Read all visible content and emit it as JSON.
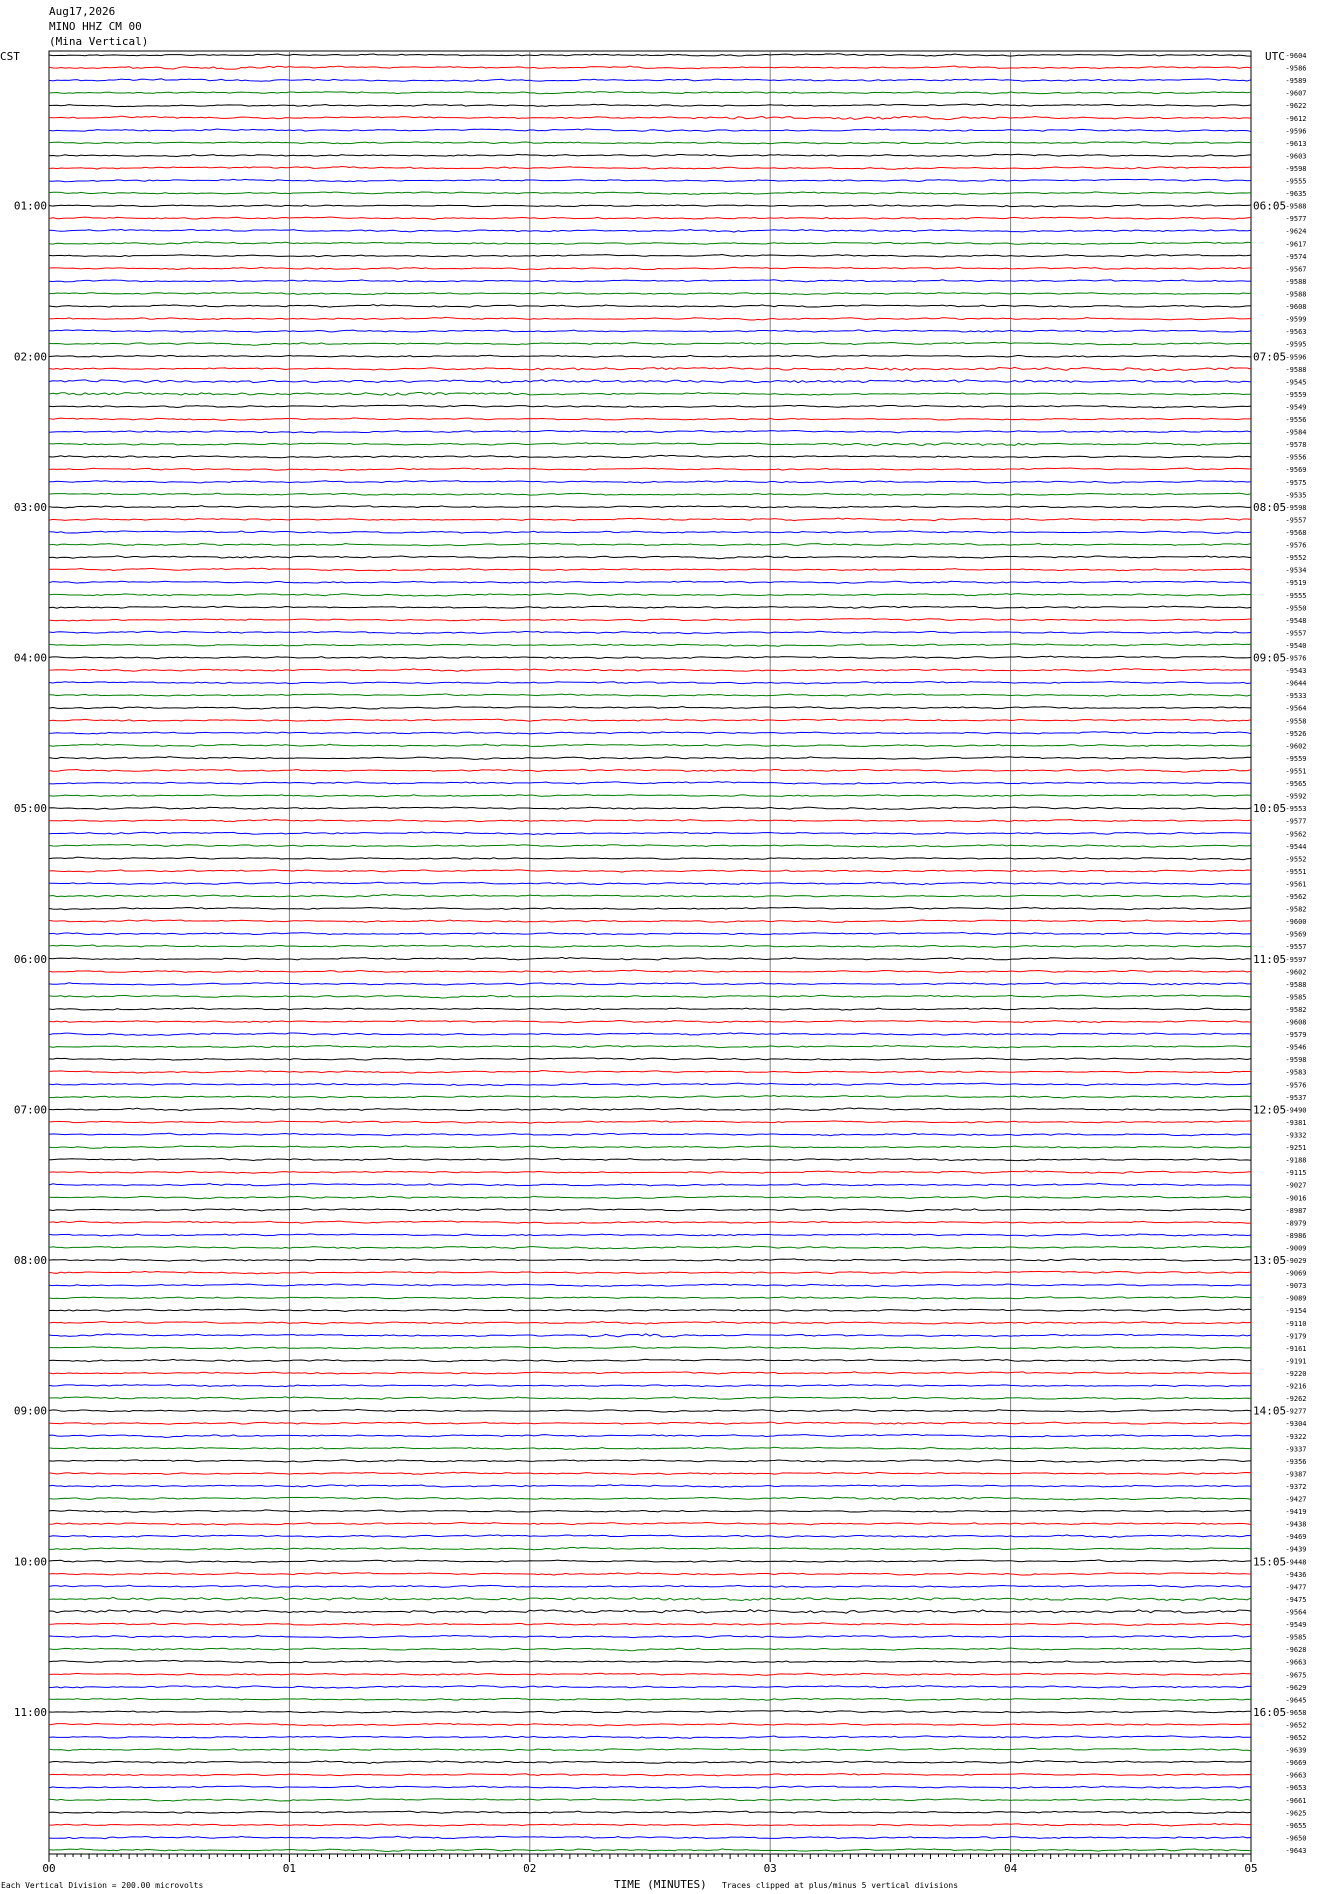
{
  "header": {
    "date": "Aug17,2026",
    "station": "MINO HHZ CM 00",
    "location": "(Mina Vertical)"
  },
  "left_timezone": "CST",
  "right_timezone": "UTC",
  "footer": {
    "scale_note": "Each Vertical Division =  200.00 microvolts",
    "x_axis_title": "TIME (MINUTES)",
    "clip_note": "Traces clipped at plus/minus 5 vertical divisions"
  },
  "chart_data": {
    "type": "line",
    "title": "",
    "xlabel": "TIME (MINUTES)",
    "xlim": [
      0,
      5
    ],
    "x_ticks": [
      "00",
      "01",
      "02",
      "03",
      "04",
      "05"
    ],
    "grid": true,
    "trace_colors": [
      "#000000",
      "#ff0000",
      "#0000ff",
      "#007f00"
    ],
    "left_hour_labels": [
      "01:00",
      "02:00",
      "03:00",
      "04:00",
      "05:00",
      "06:00",
      "07:00",
      "08:00",
      "09:00",
      "10:00",
      "11:00"
    ],
    "right_hour_labels": [
      "06:05",
      "07:05",
      "08:05",
      "09:05",
      "10:05",
      "11:05",
      "12:05",
      "13:05",
      "14:05",
      "15:05",
      "16:05"
    ],
    "traces_per_hour": 12,
    "trace_offsets": [
      "-9604",
      "-9586",
      "-9589",
      "-9607",
      "-9622",
      "-9612",
      "-9596",
      "-9613",
      "-9603",
      "-9598",
      "-9555",
      "-9635",
      "-9588",
      "-9577",
      "-9624",
      "-9617",
      "-9574",
      "-9567",
      "-9588",
      "-9588",
      "-9608",
      "-9599",
      "-9563",
      "-9595",
      "-9596",
      "-9588",
      "-9545",
      "-9559",
      "-9549",
      "-9556",
      "-9584",
      "-9578",
      "-9556",
      "-9569",
      "-9575",
      "-9535",
      "-9598",
      "-9557",
      "-9568",
      "-9576",
      "-9552",
      "-9534",
      "-9519",
      "-9555",
      "-9550",
      "-9548",
      "-9557",
      "-9540",
      "-9576",
      "-9543",
      "-9644",
      "-9533",
      "-9564",
      "-9558",
      "-9526",
      "-9602",
      "-9559",
      "-9551",
      "-9565",
      "-9592",
      "-9553",
      "-9577",
      "-9562",
      "-9544",
      "-9552",
      "-9551",
      "-9561",
      "-9562",
      "-9582",
      "-9600",
      "-9569",
      "-9557",
      "-9597",
      "-9602",
      "-9588",
      "-9585",
      "-9582",
      "-9608",
      "-9579",
      "-9546",
      "-9598",
      "-9583",
      "-9576",
      "-9537",
      "-9490",
      "-9381",
      "-9332",
      "-9251",
      "-9188",
      "-9115",
      "-9027",
      "-9016",
      "-8987",
      "-8979",
      "-8986",
      "-9009",
      "-9029",
      "-9069",
      "-9073",
      "-9089",
      "-9154",
      "-9110",
      "-9179",
      "-9161",
      "-9191",
      "-9220",
      "-9216",
      "-9262",
      "-9277",
      "-9304",
      "-9322",
      "-9337",
      "-9356",
      "-9387",
      "-9372",
      "-9427",
      "-9419",
      "-9438",
      "-9469",
      "-9439",
      "-9448",
      "-9436",
      "-9477",
      "-9475",
      "-9564",
      "-9549",
      "-9585",
      "-9628",
      "-9663",
      "-9675",
      "-9629",
      "-9645",
      "-9658",
      "-9652",
      "-9652",
      "-9639",
      "-9669",
      "-9663",
      "-9653",
      "-9661",
      "-9625",
      "-9655",
      "-9650",
      "-9643"
    ],
    "events": [
      {
        "trace": 1,
        "x_start": 0.3,
        "x_end": 1.0,
        "amplitude": "elevated"
      },
      {
        "trace": 5,
        "x_start": 2.7,
        "x_end": 4.0,
        "amplitude": "elevated"
      },
      {
        "trace": 25,
        "x_start": 2.0,
        "x_end": 5.0,
        "amplitude": "elevated"
      },
      {
        "trace": 26,
        "x_start": 0.0,
        "x_end": 5.0,
        "amplitude": "elevated"
      },
      {
        "trace": 27,
        "x_start": 0.0,
        "x_end": 2.0,
        "amplitude": "elevated"
      },
      {
        "trace": 31,
        "x_start": 3.3,
        "x_end": 4.1,
        "amplitude": "elevated"
      },
      {
        "trace": 102,
        "x_start": 2.25,
        "x_end": 2.6,
        "amplitude": "high"
      },
      {
        "trace": 115,
        "x_start": 3.25,
        "x_end": 3.95,
        "amplitude": "elevated"
      },
      {
        "trace": 123,
        "x_start": 0.2,
        "x_end": 5.0,
        "amplitude": "elevated"
      },
      {
        "trace": 124,
        "x_start": 0.0,
        "x_end": 5.0,
        "amplitude": "elevated"
      }
    ]
  }
}
